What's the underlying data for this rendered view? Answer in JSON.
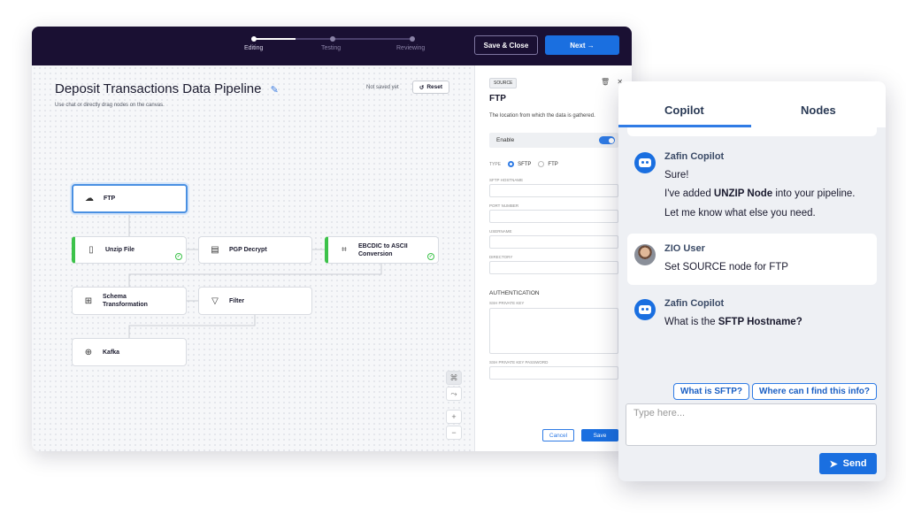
{
  "topbar": {
    "steps": [
      {
        "label": "Editing",
        "active": true
      },
      {
        "label": "Testing",
        "active": false
      },
      {
        "label": "Reviewing",
        "active": false
      }
    ],
    "save_close_label": "Save & Close",
    "next_label": "Next →"
  },
  "canvas": {
    "title": "Deposit Transactions Data Pipeline",
    "subtitle": "Use chat or directly drag nodes on the canvas.",
    "save_status": "Not saved yet",
    "reset_label": "Reset",
    "nodes": [
      {
        "label": "FTP",
        "icon": "cloud-icon",
        "state": "selected"
      },
      {
        "label": "Unzip File",
        "icon": "file-icon",
        "state": "done"
      },
      {
        "label": "PGP Decrypt",
        "icon": "document-lock-icon",
        "state": "normal"
      },
      {
        "label": "EBCDIC to ASCII Conversion",
        "icon": "hierarchy-icon",
        "state": "done"
      },
      {
        "label": "Schema Transformation",
        "icon": "schema-icon",
        "state": "normal"
      },
      {
        "label": "Filter",
        "icon": "filter-icon",
        "state": "normal"
      },
      {
        "label": "Kafka",
        "icon": "kafka-icon",
        "state": "normal"
      }
    ]
  },
  "panel": {
    "badge": "SOURCE",
    "title": "FTP",
    "description": "The location from which the data is gathered.",
    "enable_label": "Enable",
    "enabled": true,
    "type_label": "TYPE",
    "type_options": [
      "SFTP",
      "FTP"
    ],
    "type_selected": "SFTP",
    "fields": [
      {
        "label": "SFTP HOSTNAME",
        "value": ""
      },
      {
        "label": "PORT NUMBER",
        "value": ""
      },
      {
        "label": "USERNAME",
        "value": ""
      },
      {
        "label": "DIRECTORY",
        "value": ""
      }
    ],
    "auth_heading": "AUTHENTICATION",
    "ssh_key_label": "SSH PRIVATE KEY",
    "ssh_password_label": "SSH PRIVATE KEY PASSWORD",
    "cancel_label": "Cancel",
    "save_label": "Save"
  },
  "chat": {
    "tabs": [
      {
        "label": "Copilot",
        "active": true
      },
      {
        "label": "Nodes",
        "active": false
      }
    ],
    "messages": [
      {
        "sender": "Zafin Copilot",
        "type": "bot",
        "line1": "Sure!",
        "line2_pre": "I've added ",
        "line2_bold": "UNZIP Node",
        "line2_post": " into your pipeline.",
        "line3": "Let me know what else you need."
      },
      {
        "sender": "ZIO User",
        "type": "user",
        "line1": "Set SOURCE node for FTP"
      },
      {
        "sender": "Zafin Copilot",
        "type": "bot",
        "line1_pre": "What is the ",
        "line1_bold": "SFTP Hostname?"
      }
    ],
    "suggestions": [
      "What is SFTP?",
      "Where can I find this info?"
    ],
    "input_placeholder": "Type here...",
    "send_label": "Send"
  },
  "colors": {
    "topbar": "#1a1033",
    "accent": "#1a6fe0",
    "success": "#3cc24a",
    "selected_border": "#4a90e2"
  }
}
